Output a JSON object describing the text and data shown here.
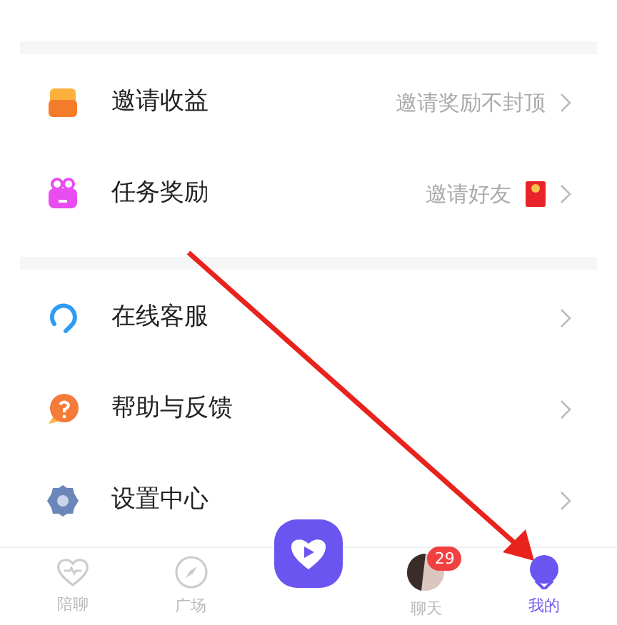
{
  "groups": [
    {
      "items": [
        {
          "kind": "coin",
          "label": "邀请收益",
          "hint": "邀请奖励不封顶",
          "red_packet": false
        },
        {
          "kind": "gift",
          "label": "任务奖励",
          "hint": "邀请好友",
          "red_packet": true
        }
      ]
    },
    {
      "items": [
        {
          "kind": "headset",
          "label": "在线客服"
        },
        {
          "kind": "help",
          "label": "帮助与反馈"
        },
        {
          "kind": "gear",
          "label": "设置中心"
        }
      ]
    }
  ],
  "tab_bar": [
    {
      "kind": "heart",
      "label": "陪聊",
      "selected": false
    },
    {
      "kind": "compass",
      "label": "广场",
      "selected": false
    },
    {
      "kind": "center",
      "selected": false
    },
    {
      "kind": "avatar",
      "label": "聊天",
      "badge": "29",
      "selected": false
    },
    {
      "kind": "me",
      "label": "我的",
      "selected": true
    }
  ]
}
